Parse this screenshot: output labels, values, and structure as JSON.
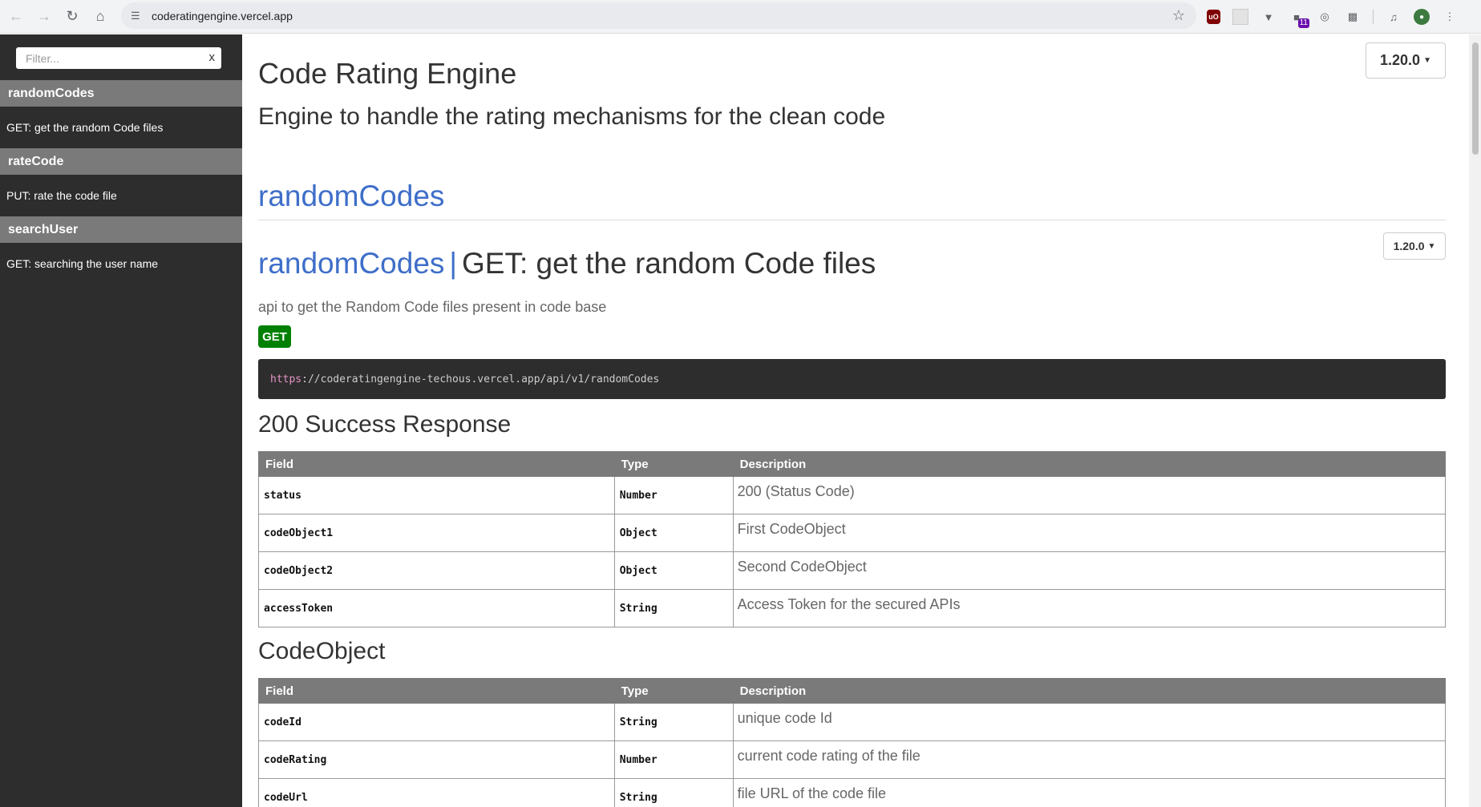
{
  "browser": {
    "url": "coderatingengine.vercel.app",
    "extension_badge": "11"
  },
  "sidebar": {
    "filter_placeholder": "Filter...",
    "filter_clear": "x",
    "groups": [
      {
        "title": "randomCodes",
        "items": [
          {
            "label": "GET: get the random Code files"
          }
        ]
      },
      {
        "title": "rateCode",
        "items": [
          {
            "label": "PUT: rate the code file"
          }
        ]
      },
      {
        "title": "searchUser",
        "items": [
          {
            "label": "GET: searching the user name"
          }
        ]
      }
    ]
  },
  "header": {
    "title": "Code Rating Engine",
    "description": "Engine to handle the rating mechanisms for the clean code",
    "version": "1.20.0"
  },
  "section": {
    "title": "randomCodes",
    "endpoint": {
      "group": "randomCodes",
      "separator": "|",
      "title": "GET: get the random Code files",
      "version": "1.20.0",
      "description": "api to get the Random Code files present in code base",
      "method": "GET",
      "method_color": "#008000",
      "url_protocol": "https",
      "url_rest": "://coderatingengine-techous.vercel.app/api/v1/randomCodes"
    }
  },
  "success_response": {
    "heading": "200 Success Response",
    "columns": [
      "Field",
      "Type",
      "Description"
    ],
    "rows": [
      {
        "field": "status",
        "type": "Number",
        "description": "200 (Status Code)"
      },
      {
        "field": "codeObject1",
        "type": "Object",
        "description": "First CodeObject"
      },
      {
        "field": "codeObject2",
        "type": "Object",
        "description": "Second CodeObject"
      },
      {
        "field": "accessToken",
        "type": "String",
        "description": "Access Token for the secured APIs"
      }
    ]
  },
  "code_object": {
    "heading": "CodeObject",
    "columns": [
      "Field",
      "Type",
      "Description"
    ],
    "rows": [
      {
        "field": "codeId",
        "type": "String",
        "description": "unique code Id"
      },
      {
        "field": "codeRating",
        "type": "Number",
        "description": "current code rating of the file"
      },
      {
        "field": "codeUrl",
        "type": "String",
        "description": "file URL of the code file"
      }
    ]
  },
  "colors": {
    "sidebar_bg": "#2d2d2d",
    "sidebar_header": "#7a7a7a",
    "link_blue": "#3e6ec9",
    "get_green": "#008000"
  }
}
